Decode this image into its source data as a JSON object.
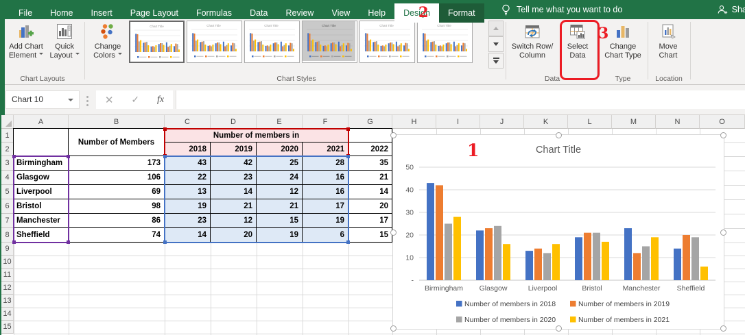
{
  "tabs": {
    "items": [
      "File",
      "Home",
      "Insert",
      "Page Layout",
      "Formulas",
      "Data",
      "Review",
      "View",
      "Help",
      "Design",
      "Format"
    ],
    "tell_me": "Tell me what you want to do",
    "share": "Share"
  },
  "ribbon": {
    "add_chart_element": {
      "line1": "Add Chart",
      "line2": "Element"
    },
    "quick_layout": {
      "line1": "Quick",
      "line2": "Layout"
    },
    "chart_layouts_label": "Chart Layouts",
    "change_colors": {
      "line1": "Change",
      "line2": "Colors"
    },
    "chart_styles_label": "Chart Styles",
    "switch_row_column": {
      "line1": "Switch Row/",
      "line2": "Column"
    },
    "select_data": {
      "line1": "Select",
      "line2": "Data"
    },
    "data_label": "Data",
    "change_chart_type": {
      "line1": "Change",
      "line2": "Chart Type"
    },
    "type_label": "Type",
    "move_chart": {
      "line1": "Move",
      "line2": "Chart"
    },
    "location_label": "Location"
  },
  "formula_bar": {
    "name_box": "Chart 10",
    "fx_label": "fx"
  },
  "grid": {
    "col_headers": [
      "A",
      "B",
      "C",
      "D",
      "E",
      "F",
      "G",
      "H",
      "I",
      "J",
      "K",
      "L",
      "M",
      "N",
      "O"
    ],
    "row_headers": [
      "1",
      "2",
      "3",
      "4",
      "5",
      "6",
      "7",
      "8",
      "9",
      "10",
      "11",
      "12",
      "13",
      "14",
      "15"
    ]
  },
  "table": {
    "b_header": "Number of Members",
    "group_header": "Number of members in",
    "years": [
      "2018",
      "2019",
      "2020",
      "2021"
    ],
    "year_extra": "2022",
    "rows": [
      {
        "city": "Birmingham",
        "total": "173",
        "values": [
          "43",
          "42",
          "25",
          "28"
        ],
        "extra": "35"
      },
      {
        "city": "Glasgow",
        "total": "106",
        "values": [
          "22",
          "23",
          "24",
          "16"
        ],
        "extra": "21"
      },
      {
        "city": "Liverpool",
        "total": "69",
        "values": [
          "13",
          "14",
          "12",
          "16"
        ],
        "extra": "14"
      },
      {
        "city": "Bristol",
        "total": "98",
        "values": [
          "19",
          "21",
          "21",
          "17"
        ],
        "extra": "20"
      },
      {
        "city": "Manchester",
        "total": "86",
        "values": [
          "23",
          "12",
          "15",
          "19"
        ],
        "extra": "17"
      },
      {
        "city": "Sheffield",
        "total": "74",
        "values": [
          "14",
          "20",
          "19",
          "6"
        ],
        "extra": "15"
      }
    ]
  },
  "annotations": {
    "step1": "1",
    "step2": "2",
    "step3": "3"
  },
  "chart_data": {
    "type": "bar",
    "title": "Chart Title",
    "categories": [
      "Birmingham",
      "Glasgow",
      "Liverpool",
      "Bristol",
      "Manchester",
      "Sheffield"
    ],
    "series": [
      {
        "name": "Number of members in 2018",
        "color": "#4472C4",
        "values": [
          43,
          22,
          13,
          19,
          23,
          14
        ]
      },
      {
        "name": "Number of members in 2019",
        "color": "#ED7D31",
        "values": [
          42,
          23,
          14,
          21,
          12,
          20
        ]
      },
      {
        "name": "Number of members in 2020",
        "color": "#A5A5A5",
        "values": [
          25,
          24,
          12,
          21,
          15,
          19
        ]
      },
      {
        "name": "Number of members in 2021",
        "color": "#FFC000",
        "values": [
          28,
          16,
          16,
          17,
          19,
          6
        ]
      }
    ],
    "ylim": [
      0,
      50
    ],
    "yticks": [
      "-",
      "10",
      "20",
      "30",
      "40",
      "50"
    ],
    "grid": true,
    "legend_position": "bottom"
  }
}
